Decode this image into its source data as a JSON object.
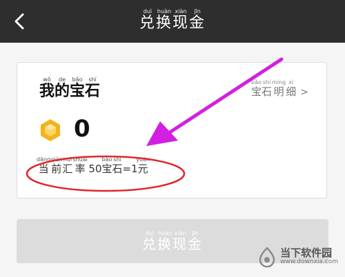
{
  "header": {
    "title_chars": [
      "兑",
      "换",
      "现",
      "金"
    ],
    "title_pinyin": [
      "duì",
      "huàn",
      "xiàn",
      "jīn"
    ]
  },
  "card": {
    "title_chars": [
      "我",
      "的",
      "宝",
      "石"
    ],
    "title_pinyin": [
      "wǒ",
      "de",
      "bǎo",
      "shí"
    ],
    "detail_chars": [
      "宝",
      "石",
      "明",
      "细"
    ],
    "detail_pinyin": [
      "bǎo",
      "shí",
      "míng",
      "xì"
    ],
    "detail_suffix": ">",
    "gem_count": "0",
    "rate_segments": [
      {
        "text": "当",
        "py": "dāng"
      },
      {
        "text": "前",
        "py": "qián"
      },
      {
        "text": "汇",
        "py": "huì"
      },
      {
        "text": "率",
        "py": "shuài"
      },
      {
        "text": " 50",
        "py": ""
      },
      {
        "text": "宝",
        "py": "bǎo"
      },
      {
        "text": "石",
        "py": "shí"
      },
      {
        "text": "=1",
        "py": ""
      },
      {
        "text": "元",
        "py": "yuán"
      }
    ]
  },
  "button": {
    "chars": [
      "兑",
      "换",
      "现",
      "金"
    ],
    "pinyin": [
      "duì",
      "huàn",
      "xiàn",
      "jīn"
    ]
  },
  "watermark": {
    "title": "当下软件园",
    "url": "www.downxia.com"
  },
  "colors": {
    "navbar": "#2e2e2e",
    "gem_gold": "#f2b31e",
    "annotation_red": "#e0252b",
    "annotation_magenta": "#d21fe0",
    "button_disabled": "#dcdcdc"
  },
  "icons": {
    "back": "chevron-left-icon",
    "gem": "gem-icon",
    "logo": "downxia-logo-icon"
  }
}
